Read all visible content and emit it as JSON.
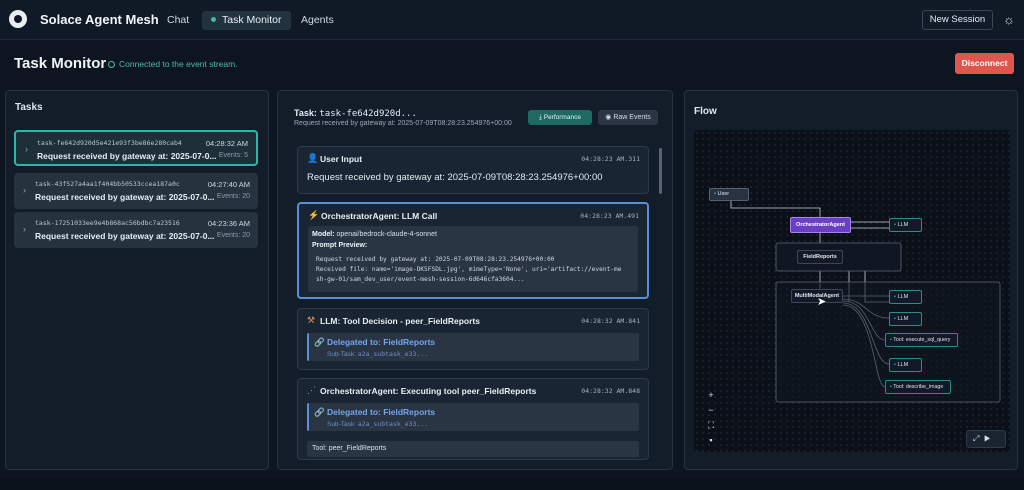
{
  "header": {
    "brand": "Solace Agent Mesh",
    "nav": [
      "Chat",
      "Task Monitor",
      "Agents"
    ],
    "new_session": "New Session",
    "theme_icon": "sun-icon"
  },
  "page": {
    "title": "Task Monitor",
    "connection_status": "Connected to the event stream.",
    "disconnect": "Disconnect"
  },
  "tasks_panel": {
    "title": "Tasks",
    "items": [
      {
        "id": "task-fe642d920d5e421e93f3be86e280cab4",
        "desc": "Request received by gateway at: 2025-07-0...",
        "time": "04:28:32 AM",
        "events": "Events: 5"
      },
      {
        "id": "task-43f527a4aa1f404bb50533ccea187a0c",
        "desc": "Request received by gateway at: 2025-07-0...",
        "time": "04:27:40 AM",
        "events": "Events: 20"
      },
      {
        "id": "task-17251033ee9e4b868ac56bdbc7a23516",
        "desc": "Request received by gateway at: 2025-07-0...",
        "time": "04:23:36 AM",
        "events": "Events: 20"
      }
    ]
  },
  "detail": {
    "title_prefix": "Task:",
    "title_id": "task-fe642d920d...",
    "subtitle": "Request received by gateway at: 2025-07-09T08:28:23.254976+00:00",
    "performance": "Performance",
    "raw_events": "Raw Events",
    "cards": [
      {
        "title": "User Input",
        "time": "04:28:23 AM.311",
        "body": "Request received by gateway at: 2025-07-09T08:28:23.254976+00:00"
      },
      {
        "title": "OrchestratorAgent: LLM Call",
        "time": "04:28:23 AM.491",
        "model_label": "Model:",
        "model": "openai/bedrock-claude-4-sonnet",
        "prompt_label": "Prompt Preview:",
        "prompt_lines": [
          "Request received by gateway at: 2025-07-09T08:28:23.254976+00:00",
          "Received file: name='image-DK5FSDL.jpg', mimeType='None', uri='artifact://event-me",
          "sh-gw-01/sam_dev_user/event-mesh-session-6d646cfa3604..."
        ]
      },
      {
        "title": "LLM: Tool Decision - peer_FieldReports",
        "time": "04:28:32 AM.841",
        "delegated": "Delegated to: FieldReports",
        "subtask_label": "Sub-Task:",
        "subtask": "a2a_subtask_e33..."
      },
      {
        "title": "OrchestratorAgent: Executing tool peer_FieldReports",
        "time": "04:28:32 AM.848",
        "delegated": "Delegated to: FieldReports",
        "subtask_label": "Sub-Task:",
        "subtask": "a2a_subtask_e33...",
        "tool_label": "Tool:",
        "tool": "peer_FieldReports"
      }
    ]
  },
  "flow": {
    "title": "Flow",
    "nodes": {
      "user": "User",
      "orchestrator": "OrchestratorAgent",
      "llm1": "LLM",
      "fieldreports": "FieldReports",
      "multimodal": "MultiModalAgent",
      "llm2": "LLM",
      "llm3": "LLM",
      "tool_sql": "Tool: execute_sql_query",
      "llm4": "LLM",
      "tool_image": "Tool: describe_image"
    },
    "controls": [
      "plus-icon",
      "minus-icon",
      "fit-view-icon",
      "lock-icon"
    ],
    "accent": "#6b3fc4"
  },
  "colors": {
    "accent_teal": "#29b8a8",
    "danger": "#e0554e",
    "link_blue": "#73a6ee"
  }
}
